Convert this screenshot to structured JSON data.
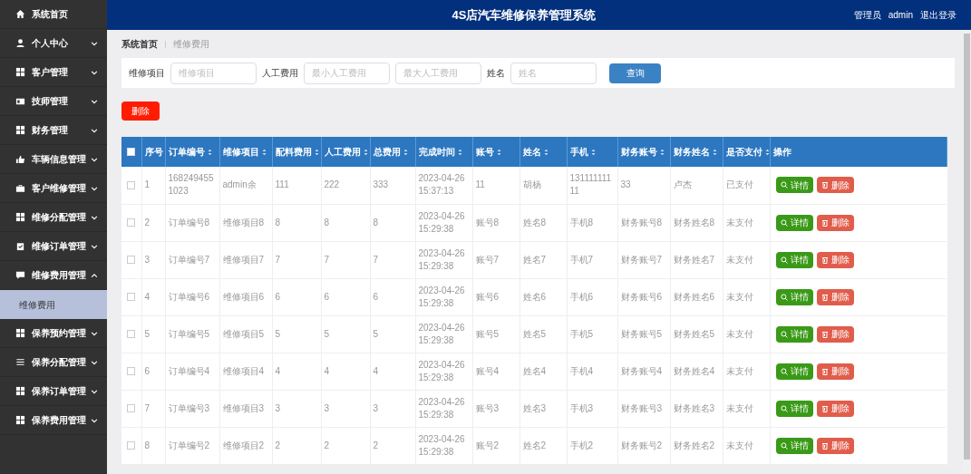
{
  "header": {
    "title": "4S店汽车维修保养管理系统",
    "user_role": "管理员",
    "username": "admin",
    "logout": "退出登录"
  },
  "sidebar": {
    "items": [
      {
        "label": "系统首页"
      },
      {
        "label": "个人中心",
        "expanded": false
      },
      {
        "label": "客户管理",
        "expanded": false
      },
      {
        "label": "技师管理",
        "expanded": false
      },
      {
        "label": "财务管理",
        "expanded": false
      },
      {
        "label": "车辆信息管理",
        "expanded": false
      },
      {
        "label": "客户维修管理",
        "expanded": false
      },
      {
        "label": "维修分配管理",
        "expanded": false
      },
      {
        "label": "维修订单管理",
        "expanded": false
      },
      {
        "label": "维修费用管理",
        "expanded": true,
        "children": [
          {
            "label": "维修费用",
            "selected": true
          }
        ]
      },
      {
        "label": "保养预约管理",
        "expanded": false
      },
      {
        "label": "保养分配管理",
        "expanded": false
      },
      {
        "label": "保养订单管理",
        "expanded": false
      },
      {
        "label": "保养费用管理",
        "expanded": false
      }
    ]
  },
  "breadcrumb": [
    "系统首页",
    "维修费用"
  ],
  "search": {
    "fields": [
      {
        "label": "维修项目",
        "placeholder": "维修项目"
      },
      {
        "label": "人工费用",
        "placeholder": "最小人工费用"
      },
      {
        "placeholder": "最大人工费用"
      },
      {
        "label": "姓名",
        "placeholder": "姓名"
      }
    ],
    "button": "查询"
  },
  "delete_button": "删除",
  "table": {
    "all_selected": false,
    "columns": [
      {
        "label": "序号",
        "sortable": false
      },
      {
        "label": "订单编号",
        "sortable": true
      },
      {
        "label": "维修项目",
        "sortable": true
      },
      {
        "label": "配料费用",
        "sortable": true
      },
      {
        "label": "人工费用",
        "sortable": true
      },
      {
        "label": "总费用",
        "sortable": true
      },
      {
        "label": "完成时间",
        "sortable": true
      },
      {
        "label": "账号",
        "sortable": true
      },
      {
        "label": "姓名",
        "sortable": true
      },
      {
        "label": "手机",
        "sortable": true
      },
      {
        "label": "财务账号",
        "sortable": true
      },
      {
        "label": "财务姓名",
        "sortable": true
      },
      {
        "label": "是否支付",
        "sortable": true
      },
      {
        "label": "操作",
        "sortable": false
      }
    ],
    "rows": [
      {
        "selected": false,
        "cells": [
          "1",
          "1682494551023",
          "admin余",
          "111",
          "222",
          "333",
          "2023-04-26 15:37:13",
          "11",
          "胡杨",
          "13111111111",
          "33",
          "卢杰",
          "已支付"
        ],
        "actions": [
          {
            "kind": "detail",
            "label": "详情"
          },
          {
            "kind": "delete",
            "label": "删除"
          }
        ]
      },
      {
        "selected": false,
        "cells": [
          "2",
          "订单编号8",
          "维修项目8",
          "8",
          "8",
          "8",
          "2023-04-26 15:29:38",
          "账号8",
          "姓名8",
          "手机8",
          "财务账号8",
          "财务姓名8",
          "未支付"
        ],
        "actions": [
          {
            "kind": "detail",
            "label": "详情"
          },
          {
            "kind": "delete",
            "label": "删除"
          }
        ]
      },
      {
        "selected": false,
        "cells": [
          "3",
          "订单编号7",
          "维修项目7",
          "7",
          "7",
          "7",
          "2023-04-26 15:29:38",
          "账号7",
          "姓名7",
          "手机7",
          "财务账号7",
          "财务姓名7",
          "未支付"
        ],
        "actions": [
          {
            "kind": "detail",
            "label": "详情"
          },
          {
            "kind": "delete",
            "label": "删除"
          }
        ]
      },
      {
        "selected": false,
        "cells": [
          "4",
          "订单编号6",
          "维修项目6",
          "6",
          "6",
          "6",
          "2023-04-26 15:29:38",
          "账号6",
          "姓名6",
          "手机6",
          "财务账号6",
          "财务姓名6",
          "未支付"
        ],
        "actions": [
          {
            "kind": "detail",
            "label": "详情"
          },
          {
            "kind": "delete",
            "label": "删除"
          }
        ]
      },
      {
        "selected": false,
        "cells": [
          "5",
          "订单编号5",
          "维修项目5",
          "5",
          "5",
          "5",
          "2023-04-26 15:29:38",
          "账号5",
          "姓名5",
          "手机5",
          "财务账号5",
          "财务姓名5",
          "未支付"
        ],
        "actions": [
          {
            "kind": "detail",
            "label": "详情"
          },
          {
            "kind": "delete",
            "label": "删除"
          }
        ]
      },
      {
        "selected": false,
        "cells": [
          "6",
          "订单编号4",
          "维修项目4",
          "4",
          "4",
          "4",
          "2023-04-26 15:29:38",
          "账号4",
          "姓名4",
          "手机4",
          "财务账号4",
          "财务姓名4",
          "未支付"
        ],
        "actions": [
          {
            "kind": "detail",
            "label": "详情"
          },
          {
            "kind": "delete",
            "label": "删除"
          }
        ]
      },
      {
        "selected": false,
        "cells": [
          "7",
          "订单编号3",
          "维修项目3",
          "3",
          "3",
          "3",
          "2023-04-26 15:29:38",
          "账号3",
          "姓名3",
          "手机3",
          "财务账号3",
          "财务姓名3",
          "未支付"
        ],
        "actions": [
          {
            "kind": "detail",
            "label": "详情"
          },
          {
            "kind": "delete",
            "label": "删除"
          }
        ]
      },
      {
        "selected": false,
        "cells": [
          "8",
          "订单编号2",
          "维修项目2",
          "2",
          "2",
          "2",
          "2023-04-26 15:29:38",
          "账号2",
          "姓名2",
          "手机2",
          "财务账号2",
          "财务姓名2",
          "未支付"
        ],
        "actions": [
          {
            "kind": "detail",
            "label": "详情"
          },
          {
            "kind": "delete",
            "label": "删除"
          }
        ]
      }
    ]
  }
}
